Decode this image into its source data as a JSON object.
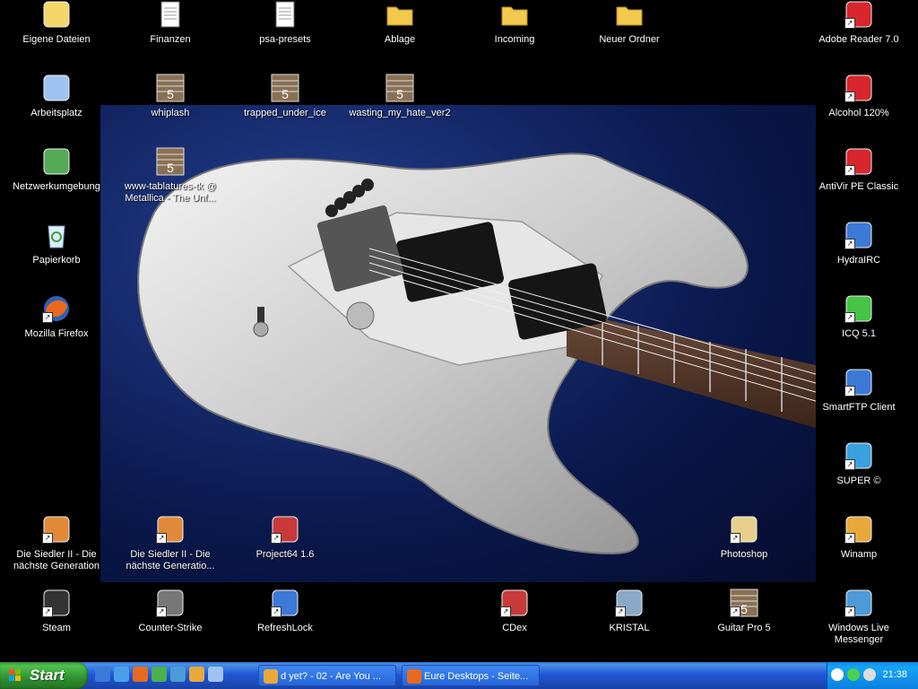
{
  "desktop": {
    "icons": [
      {
        "label": "Eigene Dateien",
        "icon": "my-documents-icon"
      },
      {
        "label": "Finanzen",
        "icon": "document-icon"
      },
      {
        "label": "psa-presets",
        "icon": "document-icon"
      },
      {
        "label": "Ablage",
        "icon": "folder-icon"
      },
      {
        "label": "Incoming",
        "icon": "folder-icon"
      },
      {
        "label": "Neuer Ordner",
        "icon": "folder-icon"
      },
      {
        "label": "Adobe Reader 7.0",
        "icon": "adobe-reader-icon"
      },
      {
        "label": "Arbeitsplatz",
        "icon": "my-computer-icon"
      },
      {
        "label": "whiplash",
        "icon": "guitar-pro-file-icon"
      },
      {
        "label": "trapped_under_ice",
        "icon": "guitar-pro-file-icon"
      },
      {
        "label": "wasting_my_hate_ver2",
        "icon": "guitar-pro-file-icon"
      },
      {
        "label": "Alcohol 120%",
        "icon": "alcohol-120-icon"
      },
      {
        "label": "Netzwerkumgebung",
        "icon": "network-icon"
      },
      {
        "label": "www-tablatures-tk @ Metallica - The Unf...",
        "icon": "guitar-pro-file-icon"
      },
      {
        "label": "AntiVir PE Classic",
        "icon": "antivir-icon"
      },
      {
        "label": "Papierkorb",
        "icon": "recycle-bin-icon"
      },
      {
        "label": "HydraIRC",
        "icon": "hydrairc-icon"
      },
      {
        "label": "Mozilla Firefox",
        "icon": "firefox-icon"
      },
      {
        "label": "ICQ 5.1",
        "icon": "icq-icon"
      },
      {
        "label": "SmartFTP Client",
        "icon": "smartftp-icon"
      },
      {
        "label": "SUPER ©",
        "icon": "super-icon"
      },
      {
        "label": "Die Siedler II - Die nächste Generation",
        "icon": "siedler-icon"
      },
      {
        "label": "Die Siedler II - Die nächste Generatio...",
        "icon": "siedler-icon"
      },
      {
        "label": "Project64 1.6",
        "icon": "project64-icon"
      },
      {
        "label": "Photoshop",
        "icon": "photoshop-icon"
      },
      {
        "label": "Winamp",
        "icon": "winamp-icon"
      },
      {
        "label": "Steam",
        "icon": "steam-icon"
      },
      {
        "label": "Counter-Strike",
        "icon": "counter-strike-icon"
      },
      {
        "label": "RefreshLock",
        "icon": "refreshlock-icon"
      },
      {
        "label": "CDex",
        "icon": "cdex-icon"
      },
      {
        "label": "KRISTAL",
        "icon": "kristal-icon"
      },
      {
        "label": "Guitar Pro 5",
        "icon": "guitar-pro-icon"
      },
      {
        "label": "Windows Live Messenger",
        "icon": "messenger-icon"
      }
    ]
  },
  "taskbar": {
    "start_label": "Start",
    "quick_launch": [
      "show-desktop-icon",
      "internet-explorer-icon",
      "firefox-icon",
      "media-player-icon",
      "messenger-icon",
      "winamp-icon",
      "window-icon"
    ],
    "tasks": [
      {
        "label": "d yet? - 02 - Are You ...",
        "icon": "winamp-icon"
      },
      {
        "label": "Eure Desktops - Seite...",
        "icon": "firefox-icon"
      }
    ],
    "clock": "21:38"
  },
  "colors": {
    "taskbar": "#245edb",
    "start": "#3c9f3c",
    "tray": "#0c8ced"
  }
}
